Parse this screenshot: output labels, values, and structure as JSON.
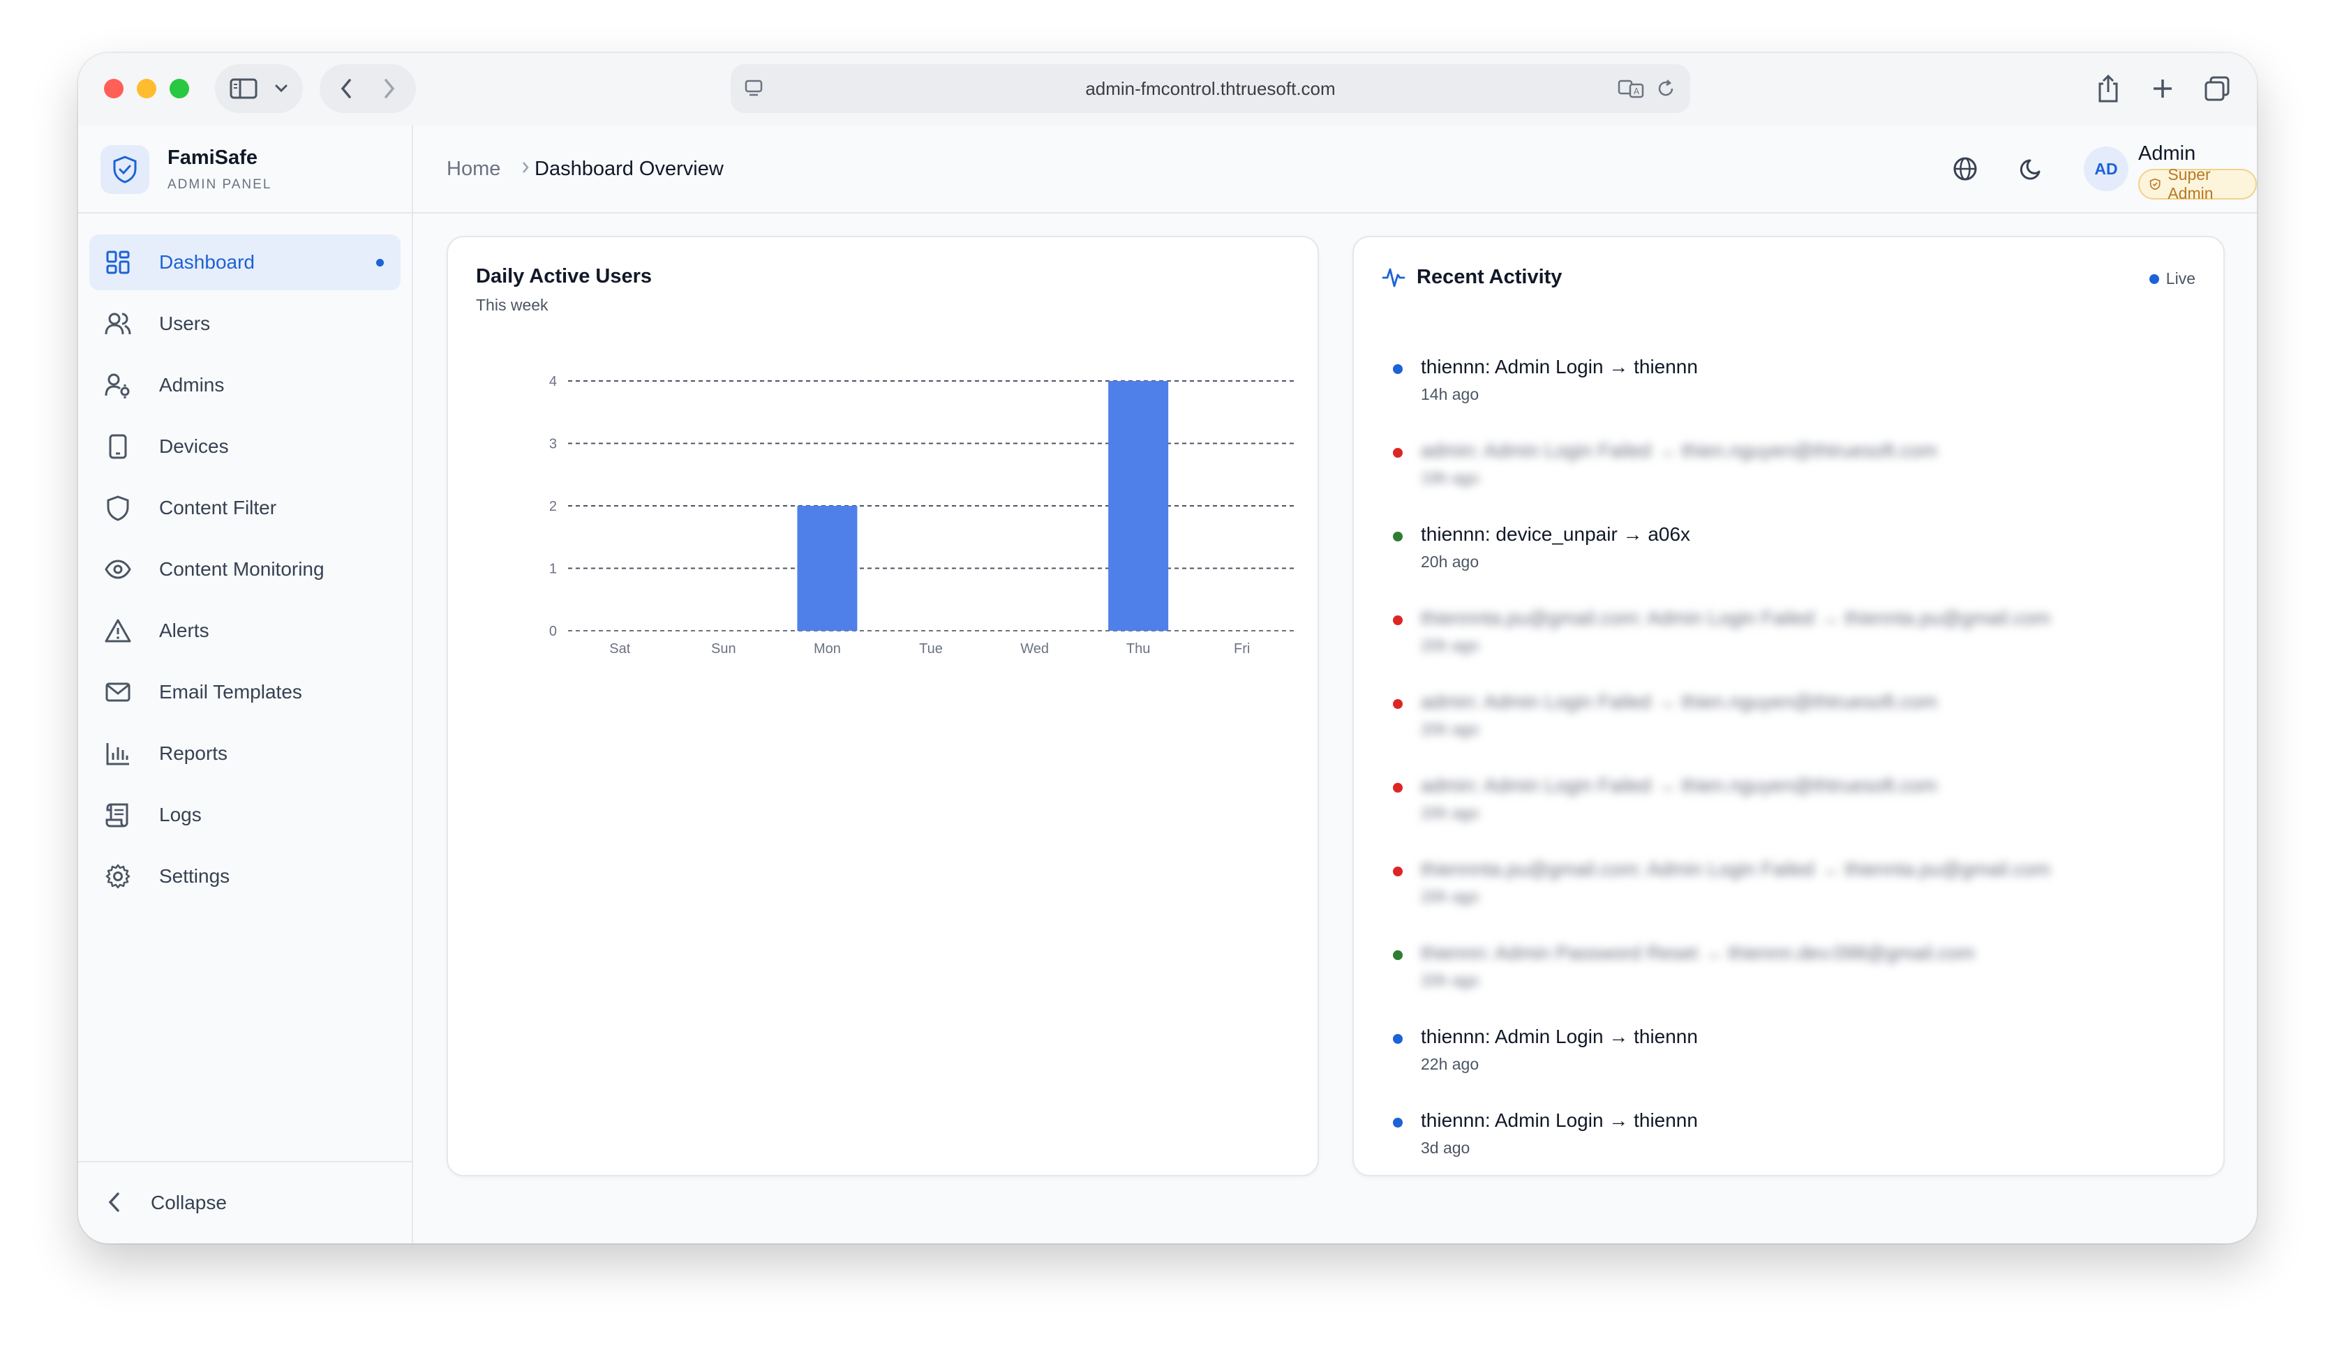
{
  "browser": {
    "url": "admin-fmcontrol.thtruesoft.com"
  },
  "brand": {
    "title": "FamiSafe",
    "subtitle": "ADMIN PANEL"
  },
  "sidebar": {
    "items": [
      {
        "label": "Dashboard",
        "icon": "dashboard-icon",
        "active": true
      },
      {
        "label": "Users",
        "icon": "users-icon"
      },
      {
        "label": "Admins",
        "icon": "admins-icon"
      },
      {
        "label": "Devices",
        "icon": "device-icon"
      },
      {
        "label": "Content Filter",
        "icon": "shield-icon"
      },
      {
        "label": "Content Monitoring",
        "icon": "eye-icon"
      },
      {
        "label": "Alerts",
        "icon": "warning-icon"
      },
      {
        "label": "Email Templates",
        "icon": "mail-icon"
      },
      {
        "label": "Reports",
        "icon": "bar-chart-icon"
      },
      {
        "label": "Logs",
        "icon": "scroll-icon"
      },
      {
        "label": "Settings",
        "icon": "gear-icon"
      }
    ],
    "collapse_label": "Collapse"
  },
  "header": {
    "breadcrumb_home": "Home",
    "breadcrumb_current": "Dashboard Overview",
    "avatar_initials": "AD",
    "admin_name": "Admin",
    "role": "Super Admin"
  },
  "chart_card": {
    "title": "Daily Active Users",
    "subtitle": "This week"
  },
  "chart_data": {
    "type": "bar",
    "title": "Daily Active Users",
    "subtitle": "This week",
    "categories": [
      "Sat",
      "Sun",
      "Mon",
      "Tue",
      "Wed",
      "Thu",
      "Fri"
    ],
    "values": [
      0,
      0,
      2,
      0,
      0,
      4,
      0
    ],
    "yticks": [
      0,
      1,
      2,
      3,
      4
    ],
    "ylim": [
      0,
      4
    ],
    "grid": true,
    "bar_color": "#4f80ea"
  },
  "activity": {
    "title": "Recent Activity",
    "live_label": "Live",
    "items": [
      {
        "text": "thiennn: Admin Login → thiennn",
        "time": "14h ago",
        "color": "#1d62d6",
        "blurred": false
      },
      {
        "text": "admin: Admin Login Failed → thien.nguyen@thtruesoft.com",
        "time": "19h ago",
        "color": "#dc2626",
        "blurred": true
      },
      {
        "text": "thiennn: device_unpair → a06x",
        "time": "20h ago",
        "color": "#2e7d32",
        "blurred": false
      },
      {
        "text": "thiennnta.pu@gmail.com: Admin Login Failed → thiennta.pu@gmail.com",
        "time": "20h ago",
        "color": "#dc2626",
        "blurred": true
      },
      {
        "text": "admin: Admin Login Failed → thien.nguyen@thtruesoft.com",
        "time": "20h ago",
        "color": "#dc2626",
        "blurred": true
      },
      {
        "text": "admin: Admin Login Failed → thien.nguyen@thtruesoft.com",
        "time": "20h ago",
        "color": "#dc2626",
        "blurred": true
      },
      {
        "text": "thiennnta.pu@gmail.com: Admin Login Failed → thiennta.pu@gmail.com",
        "time": "20h ago",
        "color": "#dc2626",
        "blurred": true
      },
      {
        "text": "thiennn: Admin Password Reset → thiennn.dev.098@gmail.com",
        "time": "20h ago",
        "color": "#2e7d32",
        "blurred": true
      },
      {
        "text": "thiennn: Admin Login → thiennn",
        "time": "22h ago",
        "color": "#1d62d6",
        "blurred": false
      },
      {
        "text": "thiennn: Admin Login → thiennn",
        "time": "3d ago",
        "color": "#1d62d6",
        "blurred": false
      }
    ]
  }
}
